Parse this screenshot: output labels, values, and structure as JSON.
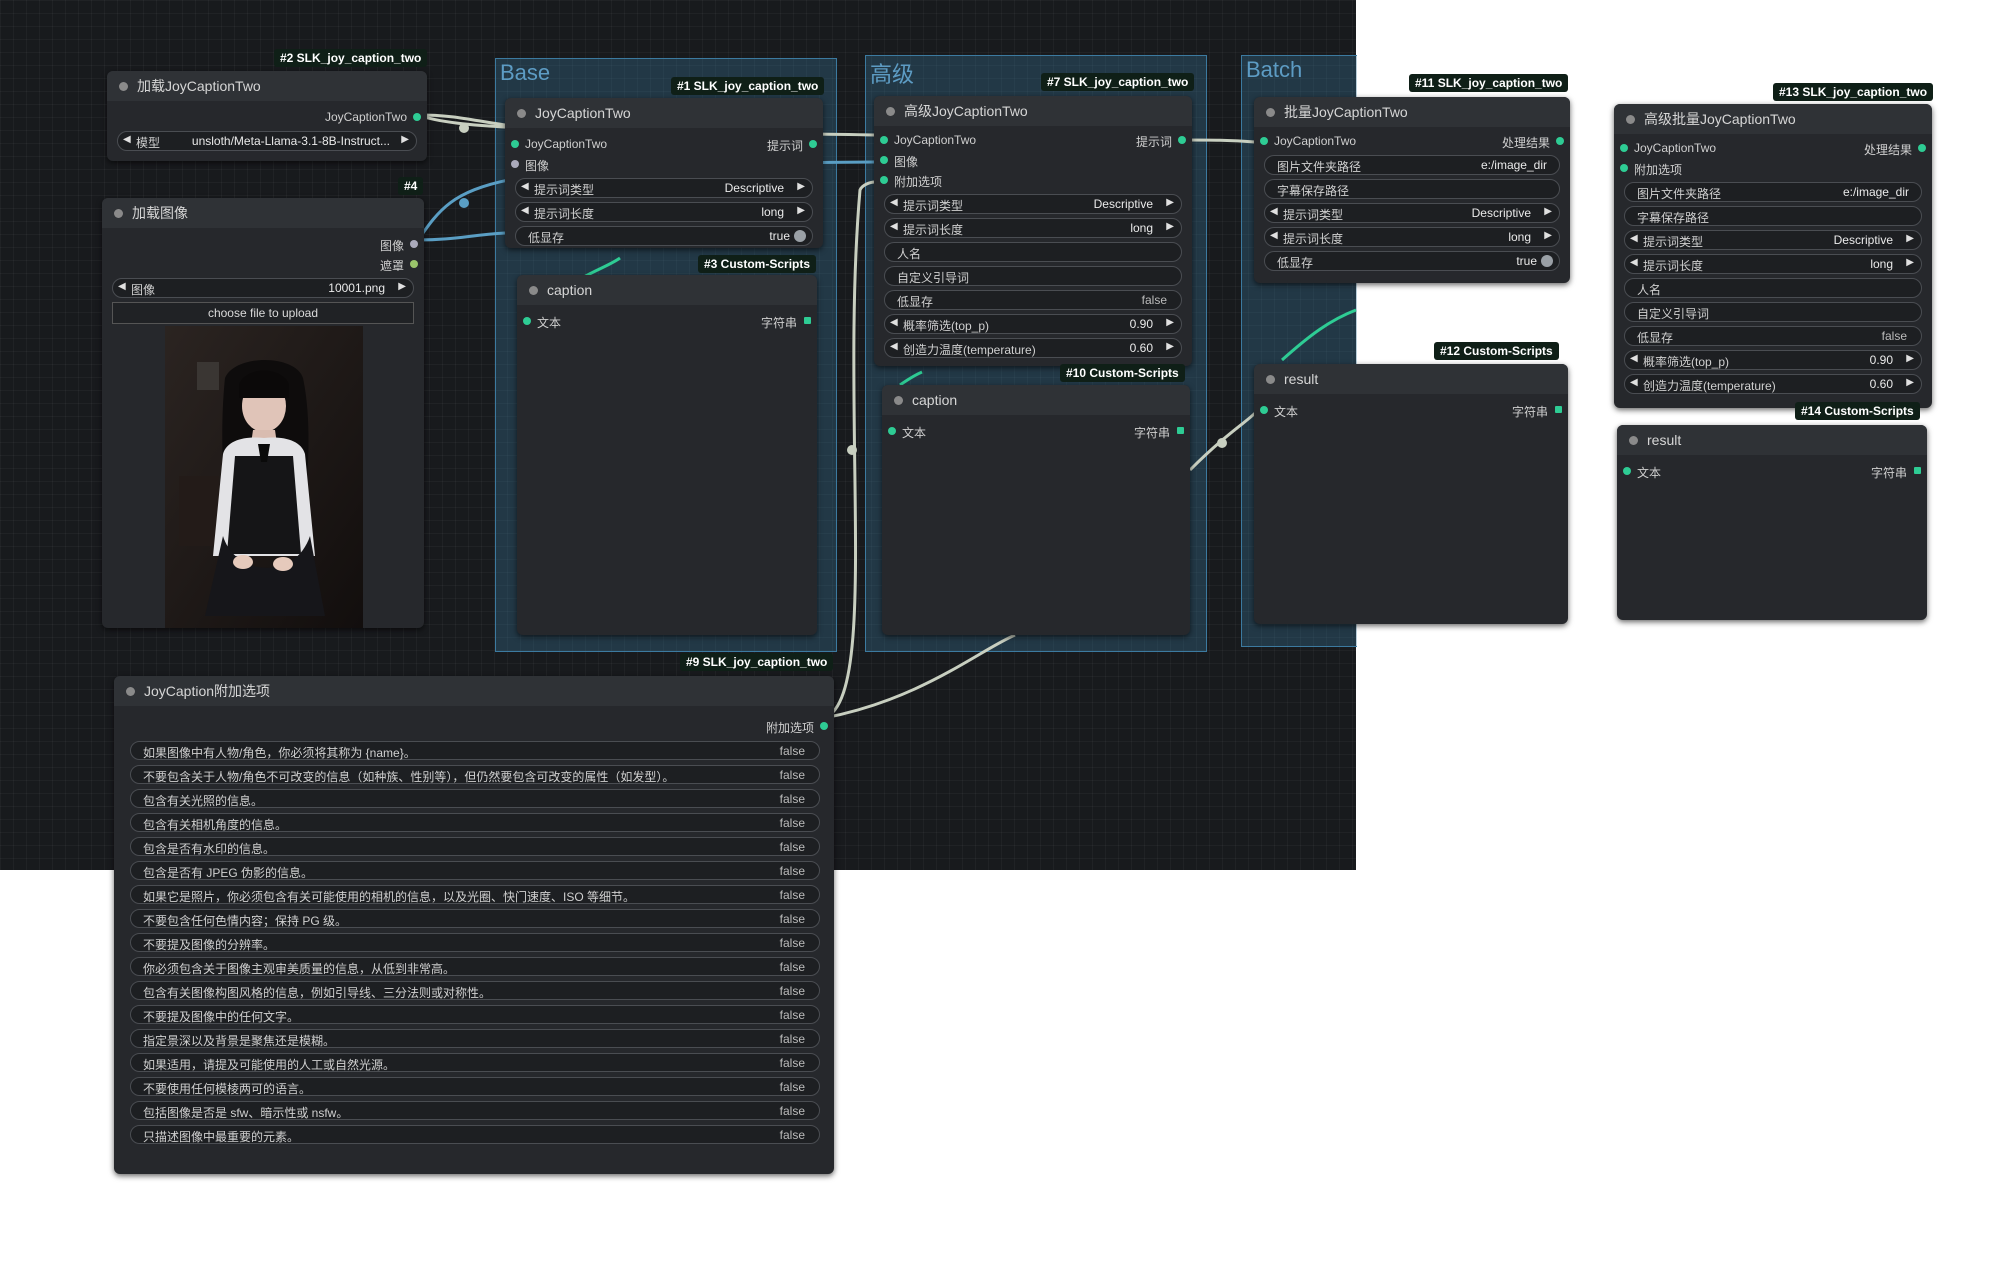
{
  "groups": {
    "base": "Base",
    "advanced": "高级",
    "batch": "Batch"
  },
  "badges": {
    "n2": "#2 SLK_joy_caption_two",
    "n4": "#4",
    "n1": "#1 SLK_joy_caption_two",
    "n3": "#3 Custom-Scripts",
    "n7": "#7 SLK_joy_caption_two",
    "n10": "#10 Custom-Scripts",
    "n11": "#11 SLK_joy_caption_two",
    "n12": "#12 Custom-Scripts",
    "n13": "#13 SLK_joy_caption_two",
    "n14": "#14 Custom-Scripts",
    "n9": "#9 SLK_joy_caption_two"
  },
  "load_model": {
    "title": "加载JoyCaptionTwo",
    "output": "JoyCaptionTwo",
    "model_label": "模型",
    "model_value": "unsloth/Meta-Llama-3.1-8B-Instruct..."
  },
  "load_image": {
    "title": "加载图像",
    "output_image": "图像",
    "output_mask": "遮罩",
    "image_label": "图像",
    "image_value": "10001.png",
    "upload_button": "choose file to upload"
  },
  "base_node": {
    "title": "JoyCaptionTwo",
    "in_model": "JoyCaptionTwo",
    "in_image": "图像",
    "out_prompt": "提示词",
    "prompt_type_label": "提示词类型",
    "prompt_type_value": "Descriptive",
    "prompt_len_label": "提示词长度",
    "prompt_len_value": "long",
    "lowvram_label": "低显存",
    "lowvram_value": "true"
  },
  "caption1": {
    "title": "caption",
    "in_text": "文本",
    "out_string": "字符串"
  },
  "adv_node": {
    "title": "高级JoyCaptionTwo",
    "in_model": "JoyCaptionTwo",
    "in_image": "图像",
    "in_extra": "附加选项",
    "out_prompt": "提示词",
    "prompt_type_label": "提示词类型",
    "prompt_type_value": "Descriptive",
    "prompt_len_label": "提示词长度",
    "prompt_len_value": "long",
    "name_label": "人名",
    "custom_label": "自定义引导词",
    "lowvram_label": "低显存",
    "lowvram_value": "false",
    "top_p_label": "概率筛选(top_p)",
    "top_p_value": "0.90",
    "temp_label": "创造力温度(temperature)",
    "temp_value": "0.60"
  },
  "caption2": {
    "title": "caption",
    "in_text": "文本",
    "out_string": "字符串"
  },
  "batch_node": {
    "title": "批量JoyCaptionTwo",
    "in_model": "JoyCaptionTwo",
    "out_result": "处理结果",
    "folder_label": "图片文件夹路径",
    "folder_value": "e:/image_dir",
    "save_label": "字幕保存路径",
    "prompt_type_label": "提示词类型",
    "prompt_type_value": "Descriptive",
    "prompt_len_label": "提示词长度",
    "prompt_len_value": "long",
    "lowvram_label": "低显存",
    "lowvram_value": "true"
  },
  "result1": {
    "title": "result",
    "in_text": "文本",
    "out_string": "字符串"
  },
  "adv_batch_node": {
    "title": "高级批量JoyCaptionTwo",
    "in_model": "JoyCaptionTwo",
    "in_extra": "附加选项",
    "out_result": "处理结果",
    "folder_label": "图片文件夹路径",
    "folder_value": "e:/image_dir",
    "save_label": "字幕保存路径",
    "prompt_type_label": "提示词类型",
    "prompt_type_value": "Descriptive",
    "prompt_len_label": "提示词长度",
    "prompt_len_value": "long",
    "name_label": "人名",
    "custom_label": "自定义引导词",
    "lowvram_label": "低显存",
    "lowvram_value": "false",
    "top_p_label": "概率筛选(top_p)",
    "top_p_value": "0.90",
    "temp_label": "创造力温度(temperature)",
    "temp_value": "0.60"
  },
  "result2": {
    "title": "result",
    "in_text": "文本",
    "out_string": "字符串"
  },
  "extra_options": {
    "title": "JoyCaption附加选项",
    "output": "附加选项",
    "options": [
      {
        "label": "如果图像中有人物/角色，你必须将其称为 {name}。",
        "value": "false"
      },
      {
        "label": "不要包含关于人物/角色不可改变的信息（如种族、性别等），但仍然要包含可改变的属性（如发型）。",
        "value": "false"
      },
      {
        "label": "包含有关光照的信息。",
        "value": "false"
      },
      {
        "label": "包含有关相机角度的信息。",
        "value": "false"
      },
      {
        "label": "包含是否有水印的信息。",
        "value": "false"
      },
      {
        "label": "包含是否有 JPEG 伪影的信息。",
        "value": "false"
      },
      {
        "label": "如果它是照片，你必须包含有关可能使用的相机的信息，以及光圈、快门速度、ISO 等细节。",
        "value": "false"
      },
      {
        "label": "不要包含任何色情内容；保持 PG 级。",
        "value": "false"
      },
      {
        "label": "不要提及图像的分辨率。",
        "value": "false"
      },
      {
        "label": "你必须包含关于图像主观审美质量的信息，从低到非常高。",
        "value": "false"
      },
      {
        "label": "包含有关图像构图风格的信息，例如引导线、三分法则或对称性。",
        "value": "false"
      },
      {
        "label": "不要提及图像中的任何文字。",
        "value": "false"
      },
      {
        "label": "指定景深以及背景是聚焦还是模糊。",
        "value": "false"
      },
      {
        "label": "如果适用，请提及可能使用的人工或自然光源。",
        "value": "false"
      },
      {
        "label": "不要使用任何模棱两可的语言。",
        "value": "false"
      },
      {
        "label": "包括图像是否是 sfw、暗示性或 nsfw。",
        "value": "false"
      },
      {
        "label": "只描述图像中最重要的元素。",
        "value": "false"
      }
    ]
  },
  "colors": {
    "canvas": "#181a1d",
    "node": "#26282c",
    "group": "#3c7aa0",
    "pin": "#2ecc94",
    "link_green": "#2ecc94",
    "link_beige": "#c8cfc0"
  }
}
